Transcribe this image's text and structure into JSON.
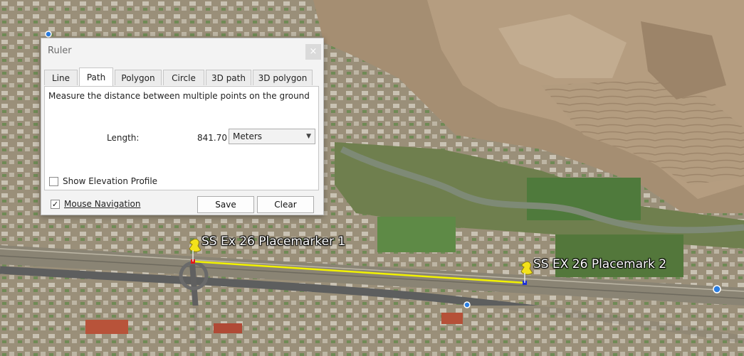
{
  "ruler_dialog": {
    "title": "Ruler",
    "close_glyph": "×",
    "tabs": [
      "Line",
      "Path",
      "Polygon",
      "Circle",
      "3D path",
      "3D polygon"
    ],
    "active_tab": "Path",
    "description": "Measure the distance between multiple points on the ground",
    "length_label": "Length:",
    "length_value": "841.70",
    "unit_selected": "Meters",
    "show_elevation_label": "Show Elevation Profile",
    "show_elevation_checked": false,
    "mouse_navigation_label": "Mouse Navigation",
    "mouse_navigation_checked": true,
    "mouse_navigation_check_glyph": "✓",
    "save_label": "Save",
    "clear_label": "Clear"
  },
  "map": {
    "placemark_1_label": "SS Ex 26 Placemarker 1",
    "placemark_2_label": "SS EX 26 Placemark 2",
    "path_color": "#f2f200",
    "pin_color": "#f3e21a",
    "icons": [
      "pushpin-icon",
      "pushpin-icon",
      "blue-circle-icon"
    ]
  }
}
